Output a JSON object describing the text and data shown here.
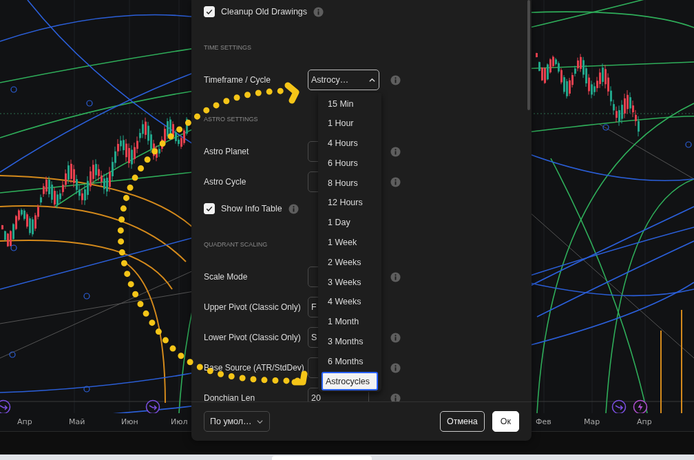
{
  "chart": {
    "axis_labels": [
      "Апр",
      "Май",
      "Июн",
      "Июл",
      "Фев",
      "Мар",
      "Апр"
    ]
  },
  "dialog": {
    "rows": [
      {
        "kind": "checkbox",
        "label": "Cleanup Old Drawings",
        "checked": true,
        "info": true
      },
      {
        "kind": "section",
        "label": "TIME SETTINGS"
      },
      {
        "kind": "dropdown",
        "label": "Timeframe / Cycle",
        "value": "Astrocy…",
        "expanded": true,
        "info": true
      },
      {
        "kind": "section",
        "label": "ASTRO SETTINGS"
      },
      {
        "kind": "select",
        "label": "Astro Planet",
        "info": true
      },
      {
        "kind": "select",
        "label": "Astro Cycle",
        "info": true
      },
      {
        "kind": "checkbox",
        "label": "Show Info Table",
        "checked": true,
        "info": true
      },
      {
        "kind": "section",
        "label": "QUADRANT SCALING"
      },
      {
        "kind": "select",
        "label": "Scale Mode",
        "info": true
      },
      {
        "kind": "select",
        "label": "Upper Pivot (Classic Only)",
        "value": "F"
      },
      {
        "kind": "select",
        "label": "Lower Pivot (Classic Only)",
        "value": "S",
        "info": true
      },
      {
        "kind": "select",
        "label": "Base Source (ATR/StdDev)",
        "info": true
      },
      {
        "kind": "number",
        "label": "Donchian Len",
        "value": "20",
        "info": true
      }
    ],
    "dropdown_options": [
      {
        "label": "15 Min",
        "selected": false
      },
      {
        "label": "1 Hour",
        "selected": false
      },
      {
        "label": "4 Hours",
        "selected": false
      },
      {
        "label": "6 Hours",
        "selected": false
      },
      {
        "label": "8 Hours",
        "selected": false
      },
      {
        "label": "12 Hours",
        "selected": false
      },
      {
        "label": "1 Day",
        "selected": false
      },
      {
        "label": "1 Week",
        "selected": false
      },
      {
        "label": "2 Weeks",
        "selected": false
      },
      {
        "label": "3 Weeks",
        "selected": false
      },
      {
        "label": "4 Weeks",
        "selected": false
      },
      {
        "label": "1 Month",
        "selected": false
      },
      {
        "label": "3 Months",
        "selected": false
      },
      {
        "label": "6 Months",
        "selected": false
      },
      {
        "label": "Astrocycles",
        "selected": true
      }
    ],
    "footer": {
      "template": "По умол…",
      "cancel": "Отмена",
      "ok": "Ок"
    }
  }
}
